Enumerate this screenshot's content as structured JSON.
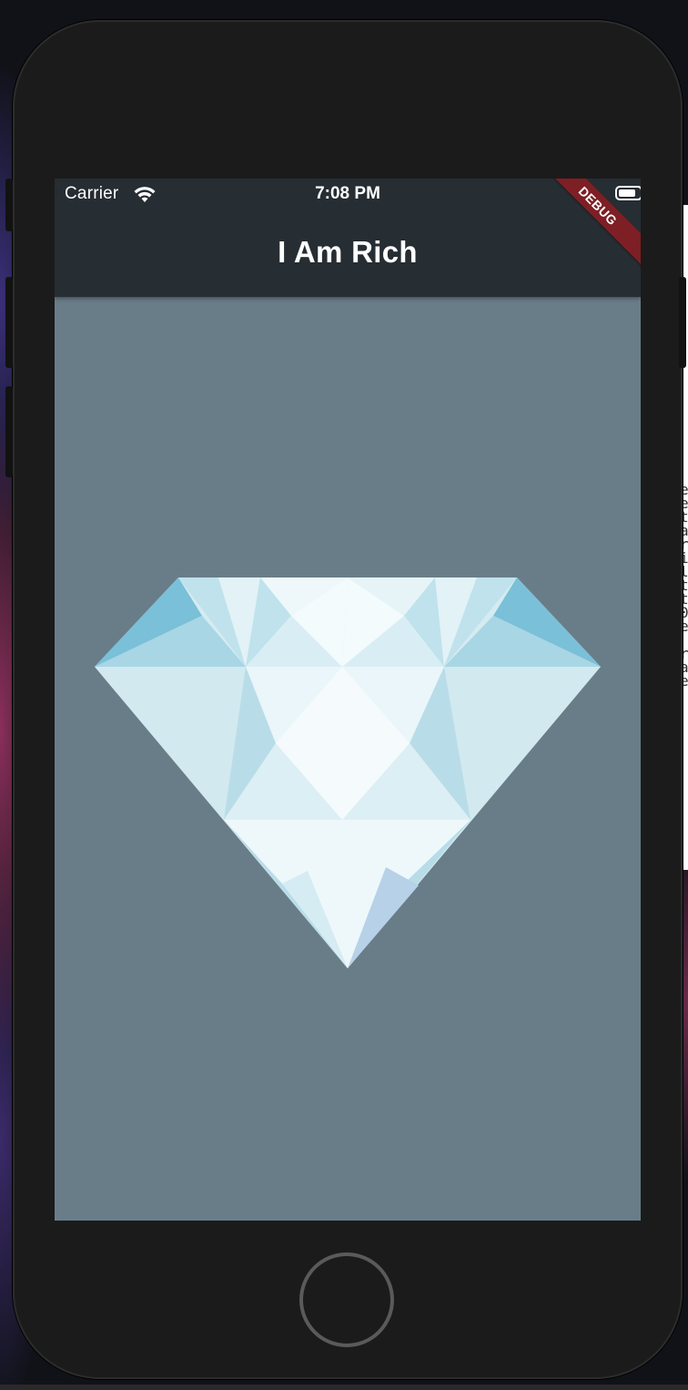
{
  "status_bar": {
    "carrier": "Carrier",
    "time": "7:08 PM",
    "wifi_icon": "wifi-icon",
    "battery_icon": "battery-icon"
  },
  "app_bar": {
    "title": "I Am Rich"
  },
  "debug_banner": {
    "label": "DEBUG"
  },
  "body": {
    "image": "diamond-image",
    "background_color": "#697d89"
  },
  "colors": {
    "app_bar": "#262d33",
    "debug_banner": "#7d1f24"
  },
  "desktop": {
    "side_code_glyphs": "e\ne\nt\na\nr\ni\nl\nt\nt\n0\ne\n\nr\na\ne"
  }
}
